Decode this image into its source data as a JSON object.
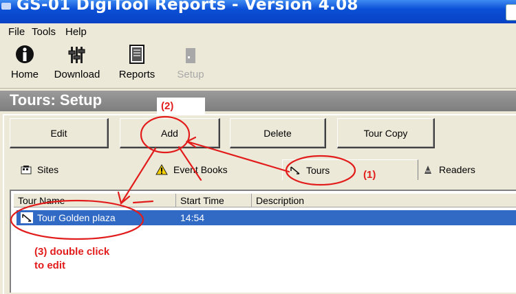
{
  "window": {
    "title": "GS-01 DigiTool Reports - Version 4.08"
  },
  "menu": {
    "items": [
      "File",
      "Tools",
      "Help"
    ]
  },
  "toolbar": {
    "items": [
      {
        "label": "Home",
        "icon": "info-icon",
        "enabled": true
      },
      {
        "label": "Download",
        "icon": "download-icon",
        "enabled": true
      },
      {
        "label": "Reports",
        "icon": "reports-icon",
        "enabled": true
      },
      {
        "label": "Setup",
        "icon": "setup-icon",
        "enabled": false
      }
    ]
  },
  "heading": {
    "title": "Tours: Setup"
  },
  "actions": {
    "edit": "Edit",
    "add": "Add",
    "delete": "Delete",
    "tour_copy": "Tour Copy"
  },
  "tabs": [
    {
      "label": "Sites",
      "icon": "sites-icon",
      "selected": false
    },
    {
      "label": "Event Books",
      "icon": "warning-icon",
      "selected": false
    },
    {
      "label": "Tours",
      "icon": "tours-icon",
      "selected": true
    },
    {
      "label": "Readers",
      "icon": "readers-icon",
      "selected": false
    }
  ],
  "table": {
    "columns": [
      "Tour Name",
      "Start Time",
      "Description"
    ],
    "rows": [
      {
        "name": "Tour  Golden plaza",
        "start_time": "14:54",
        "description": ""
      }
    ]
  },
  "annotations": {
    "step1": "(1)",
    "step2": "(2)",
    "step3_line1": "(3) double click",
    "step3_line2": "to edit",
    "color": "#e21b1b"
  },
  "colors": {
    "titlebar": "#0a4fd6",
    "heading_bg": "#8a8a8a",
    "selection": "#316ac5",
    "window_bg": "#ece9d8"
  }
}
